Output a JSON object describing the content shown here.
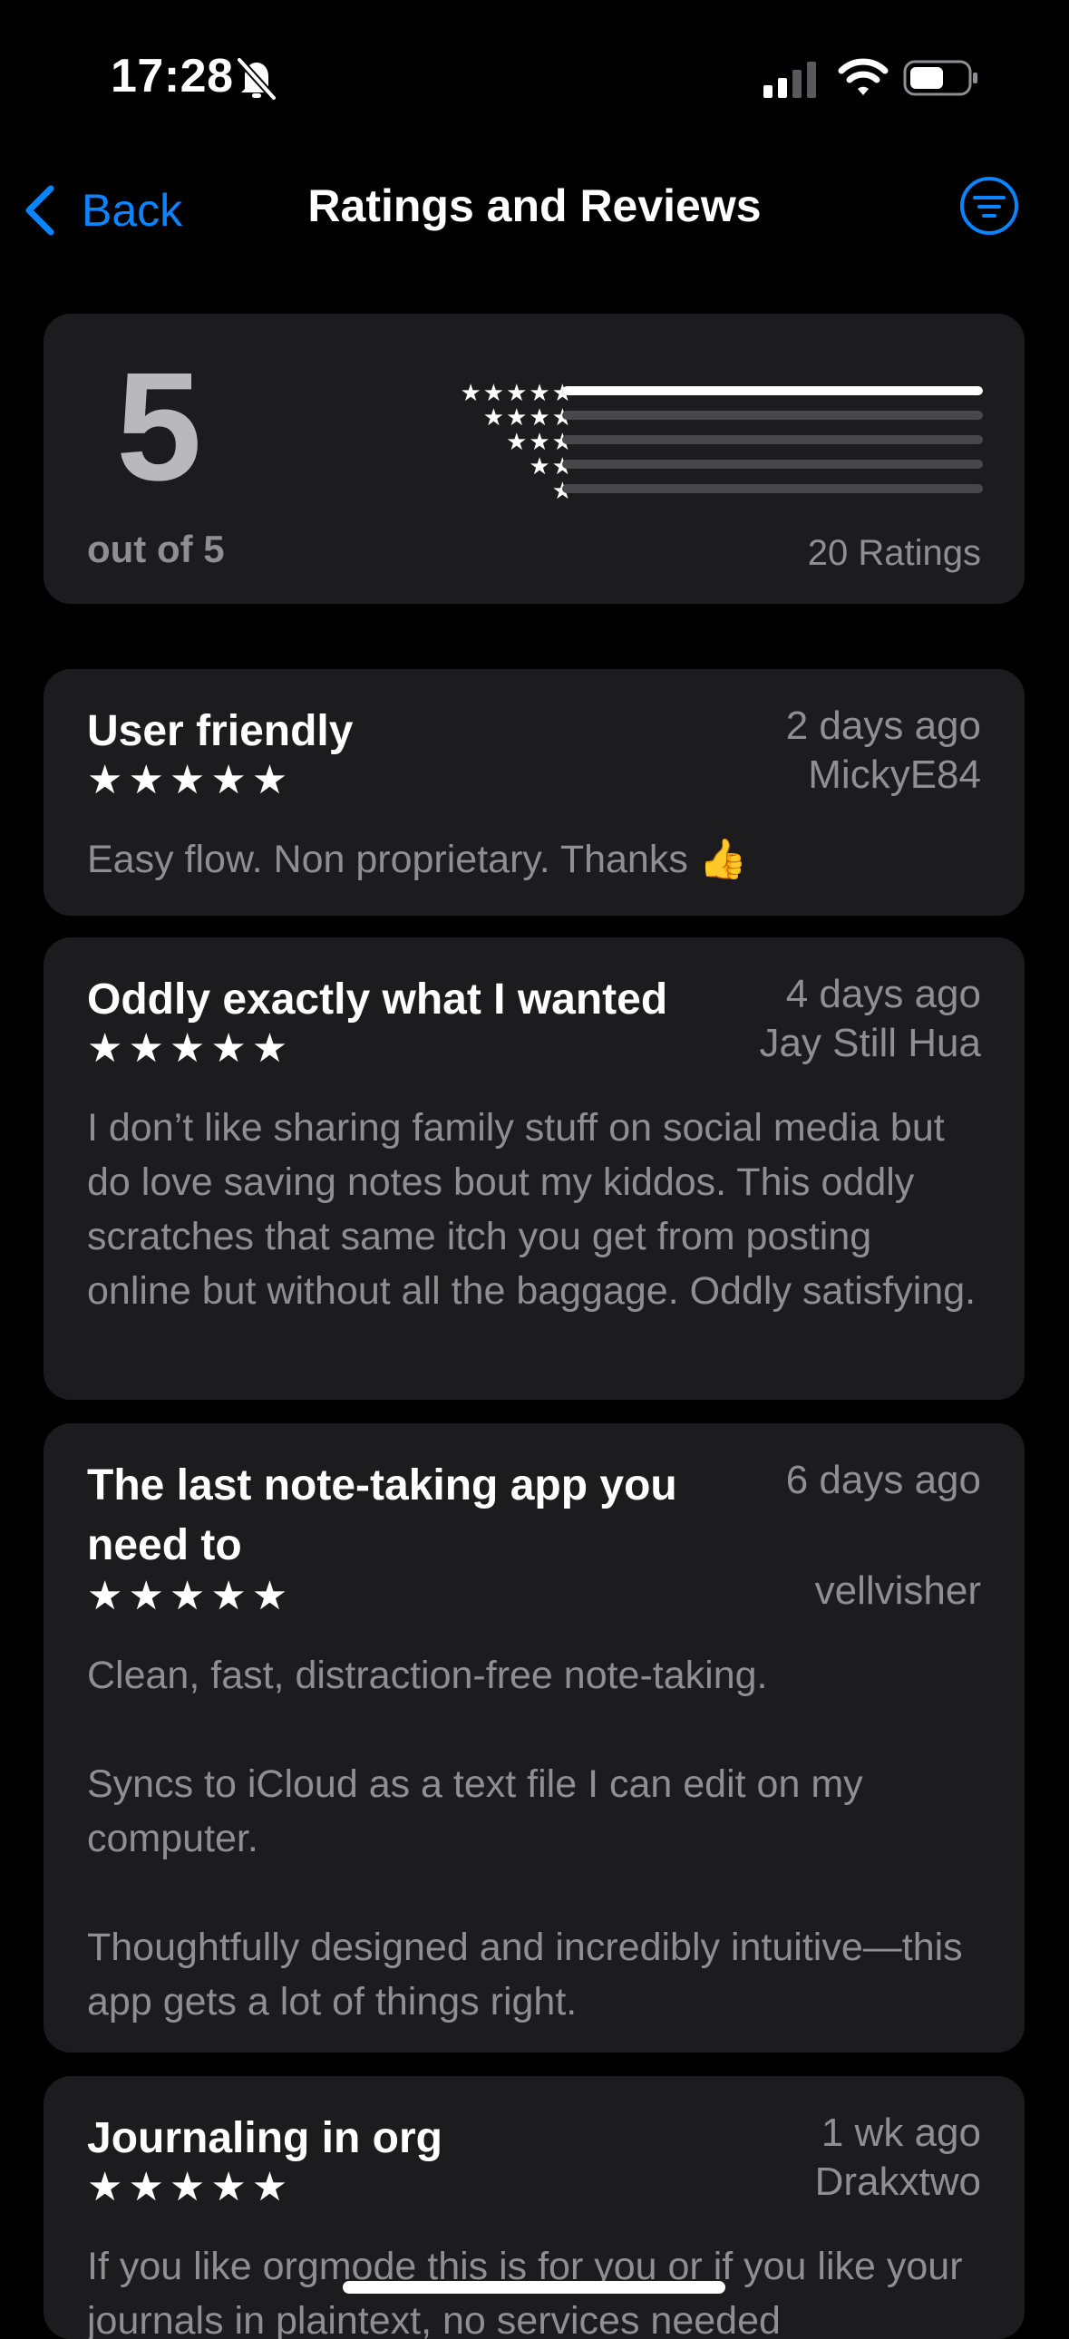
{
  "status_bar": {
    "time": "17:28",
    "icons": [
      "bell-slash-icon",
      "cellular-signal-icon",
      "wifi-icon",
      "battery-icon"
    ]
  },
  "nav": {
    "back_label": "Back",
    "title": "Ratings and Reviews",
    "filter_icon": "filter-icon",
    "accent_color": "#0a84ff"
  },
  "summary": {
    "average": "5",
    "out_of": "out of 5",
    "ratings_count": "20 Ratings",
    "distribution": [
      {
        "stars": 5,
        "fraction": 1.0
      },
      {
        "stars": 4,
        "fraction": 0.0
      },
      {
        "stars": 3,
        "fraction": 0.0
      },
      {
        "stars": 2,
        "fraction": 0.0
      },
      {
        "stars": 1,
        "fraction": 0.0
      }
    ]
  },
  "reviews": [
    {
      "title": "User friendly",
      "date": "2 days ago",
      "author": "MickyE84",
      "stars": "★★★★★",
      "body": "Easy flow. Non proprietary. Thanks 👍"
    },
    {
      "title": "Oddly exactly what I wanted",
      "date": "4 days ago",
      "author": "Jay Still Hua",
      "stars": "★★★★★",
      "body": "I don’t like sharing family stuff on social media but do love saving notes bout my kiddos. This oddly scratches that same itch you get from posting online but without all the baggage. Oddly satisfying."
    },
    {
      "title": "The last note-taking app you need to",
      "date": "6 days ago",
      "author": "vellvisher",
      "stars": "★★★★★",
      "body": "Clean, fast, distraction-free note-taking.\n\nSyncs to iCloud as a text file I can edit on my computer.\n\nThoughtfully designed and incredibly intuitive—this app gets a lot of things right."
    },
    {
      "title": "Journaling in org",
      "date": "1 wk ago",
      "author": "Drakxtwo",
      "stars": "★★★★★",
      "body": "If you like orgmode this is for you or if you like your journals in plaintext, no services needed"
    }
  ]
}
